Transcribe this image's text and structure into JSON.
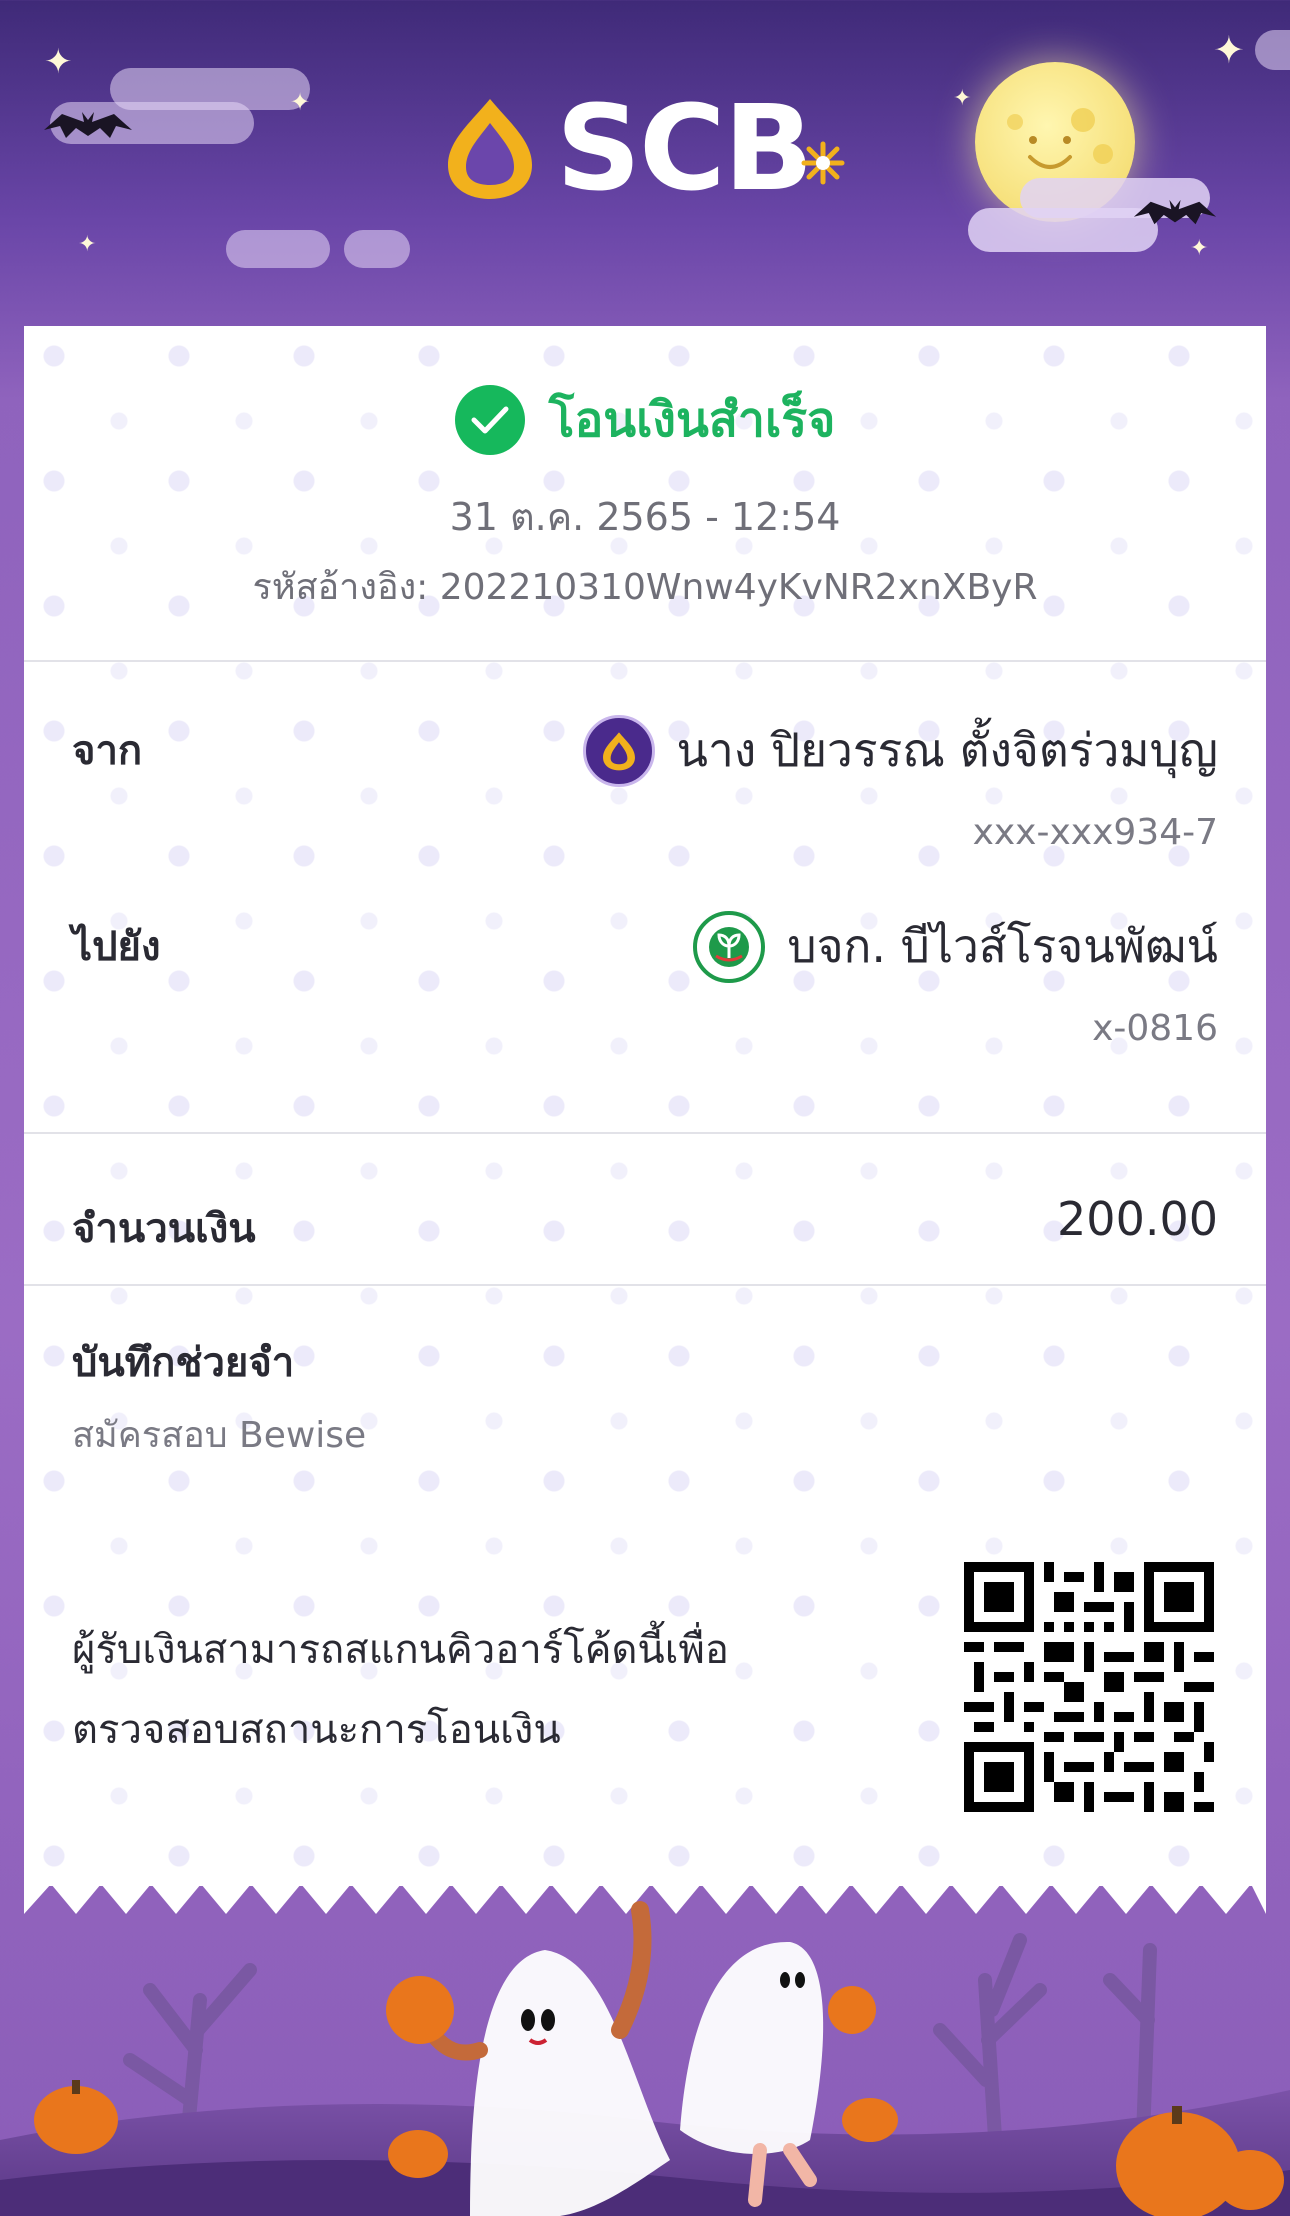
{
  "header": {
    "brand_name": "SCB",
    "brand_colors": {
      "primary": "#4a2a8c",
      "gold": "#f2b11c"
    },
    "theme": "halloween"
  },
  "receipt": {
    "status": "โอนเงินสำเร็จ",
    "status_color": "#1db35f",
    "datetime": "31 ต.ค. 2565 - 12:54",
    "reference": "รหัสอ้างอิง: 202210310Wnw4yKvNR2xnXByR",
    "from": {
      "label": "จาก",
      "name": "นาง ปิยวรรณ ตั้งจิตร่วมบุญ",
      "account": "xxx-xxx934-7",
      "bank_icon": "scb-icon"
    },
    "to": {
      "label": "ไปยัง",
      "name": "บจก. บีไวส์โรจนพัฒน์",
      "account": "x-0816",
      "bank_icon": "kbank-icon"
    },
    "amount": {
      "label": "จำนวนเงิน",
      "value": "200.00"
    },
    "memo": {
      "label": "บันทึกช่วยจำ",
      "value": "สมัครสอบ Bewise"
    },
    "qr": {
      "line1": "ผู้รับเงินสามารถสแกนคิวอาร์โค้ดนี้เพื่อ",
      "line2": "ตรวจสอบสถานะการโอนเงิน",
      "icon": "qr-code-icon"
    }
  }
}
